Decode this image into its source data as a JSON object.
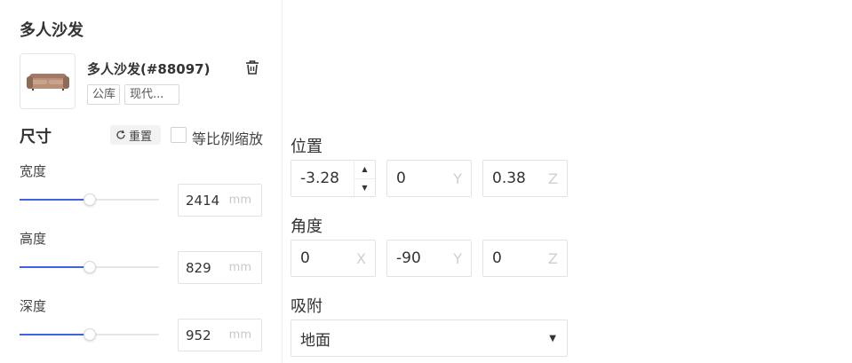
{
  "panel": {
    "title": "多人沙发",
    "product_name": "多人沙发(#88097)",
    "tags": [
      "公库",
      "现代..."
    ]
  },
  "size": {
    "title": "尺寸",
    "reset_label": "重置",
    "ratio_label": "等比例缩放",
    "ratio_checked": false,
    "dimensions": [
      {
        "label": "宽度",
        "value": "2414",
        "unit": "mm",
        "slider_fraction": 0.5
      },
      {
        "label": "高度",
        "value": "829",
        "unit": "mm",
        "slider_fraction": 0.5
      },
      {
        "label": "深度",
        "value": "952",
        "unit": "mm",
        "slider_fraction": 0.5
      }
    ]
  },
  "position": {
    "title": "位置",
    "x": {
      "value": "-3.28",
      "axis": ""
    },
    "y": {
      "value": "0",
      "axis": "Y"
    },
    "z": {
      "value": "0.38",
      "axis": "Z"
    }
  },
  "angle": {
    "title": "角度",
    "x": {
      "value": "0",
      "axis": "X"
    },
    "y": {
      "value": "-90",
      "axis": "Y"
    },
    "z": {
      "value": "0",
      "axis": "Z"
    }
  },
  "snap": {
    "title": "吸附",
    "selected": "地面"
  },
  "colors": {
    "accent": "#3e63dd"
  }
}
